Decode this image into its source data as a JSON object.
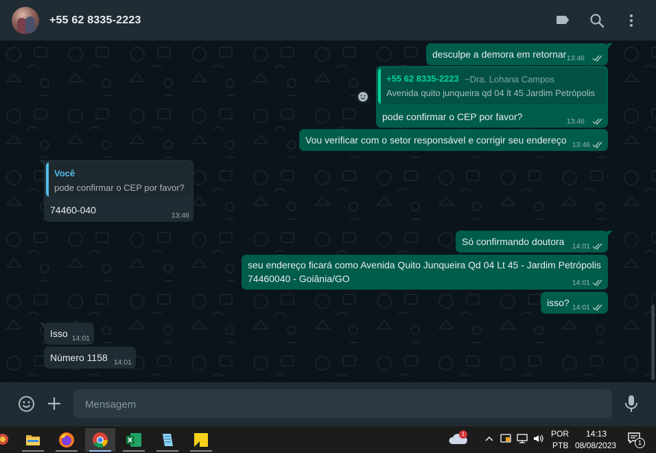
{
  "header": {
    "contact": "+55 62 8335-2223",
    "icons": [
      "label-icon",
      "search-icon",
      "more-vertical-icon"
    ]
  },
  "messages": [
    {
      "dir": "out",
      "text": "desculpe a demora em retornar",
      "time": "13:46",
      "read": true
    },
    {
      "dir": "out",
      "quote": {
        "name": "+55 62 8335-2223",
        "pushname": "~Dra. Lohana Campos",
        "text": "Avenida quito junqueira qd 04 lt 45 Jardim Petrópolis"
      },
      "text": "pode confirmar o CEP por favor?",
      "time": "13:46",
      "read": true
    },
    {
      "dir": "out",
      "text": "Vou verificar com o setor responsável e corrigir seu endereço",
      "time": "13:46",
      "read": true
    },
    {
      "dir": "in",
      "quote": {
        "name": "Você",
        "text": "pode confirmar o CEP por favor?"
      },
      "text": "74460-040",
      "time": "13:46"
    },
    {
      "dir": "out",
      "text": "Só confirmando doutora",
      "time": "14:01",
      "read": true
    },
    {
      "dir": "out",
      "text_lines": [
        "seu endereço ficará como Avenida Quito Junqueira Qd 04 Lt 45 - Jardim Petrópolis",
        "74460040 - Goiânia/GO"
      ],
      "time": "14:01",
      "read": true
    },
    {
      "dir": "out",
      "text": "isso?",
      "time": "14:01",
      "read": true
    },
    {
      "dir": "in",
      "text": "Isso",
      "time": "14:01"
    },
    {
      "dir": "in",
      "text": "Número 1158",
      "time": "14:01"
    }
  ],
  "composer": {
    "placeholder": "Mensagem",
    "icons": [
      "emoji-icon",
      "plus-icon",
      "microphone-icon"
    ]
  },
  "colors": {
    "header_bg": "#202c33",
    "chat_bg": "#0b141a",
    "outgoing_bubble": "#005c4b",
    "incoming_bubble": "#202c33",
    "read_ticks": "#53bdeb",
    "quote_name_out": "#06cf9c",
    "quote_name_in": "#53bdeb"
  },
  "taskbar": {
    "apps": [
      "file-explorer-icon",
      "firefox-icon",
      "chrome-icon",
      "excel-icon",
      "notepad-icon",
      "sticky-notes-icon"
    ],
    "cloud_badge": "1",
    "lang_line1": "POR",
    "lang_line2": "PTB",
    "clock_time": "14:13",
    "clock_date": "08/08/2023",
    "notifications": "1"
  }
}
